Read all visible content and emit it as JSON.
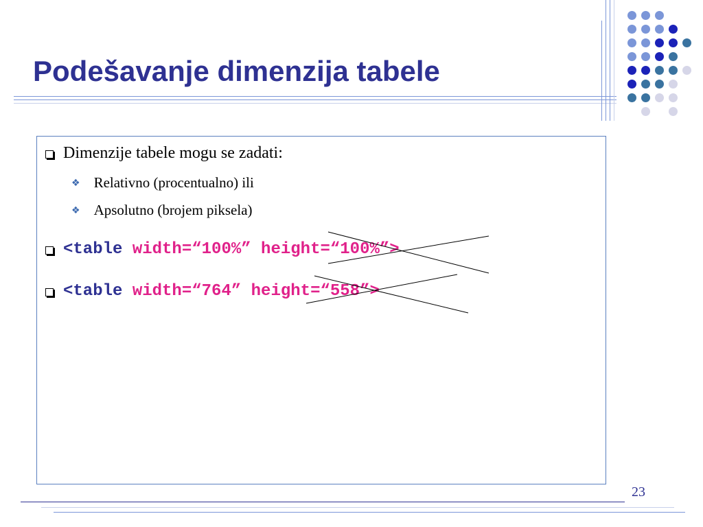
{
  "slide": {
    "title": "Podešavanje dimenzija tabele",
    "page_number": "23"
  },
  "content": {
    "intro": "Dimenzije tabele mogu se zadati:",
    "sub_items": [
      "Relativno (procentualno) ili",
      "Apsolutno (brojem piksela)"
    ],
    "code_lines": [
      {
        "tag": "<table",
        "attr": " width=“100%” height=“100%”>"
      },
      {
        "tag": "<table",
        "attr": " width=“764” height=“558”>"
      }
    ]
  },
  "colors": {
    "title": "#2e3192",
    "code_tag": "#2e3192",
    "code_attr": "#e0218a",
    "box_border": "#5a7fbf",
    "dot_palette": [
      "#7b96d8",
      "#1b22b8",
      "#3a73a0",
      "#d6d6e8"
    ]
  }
}
